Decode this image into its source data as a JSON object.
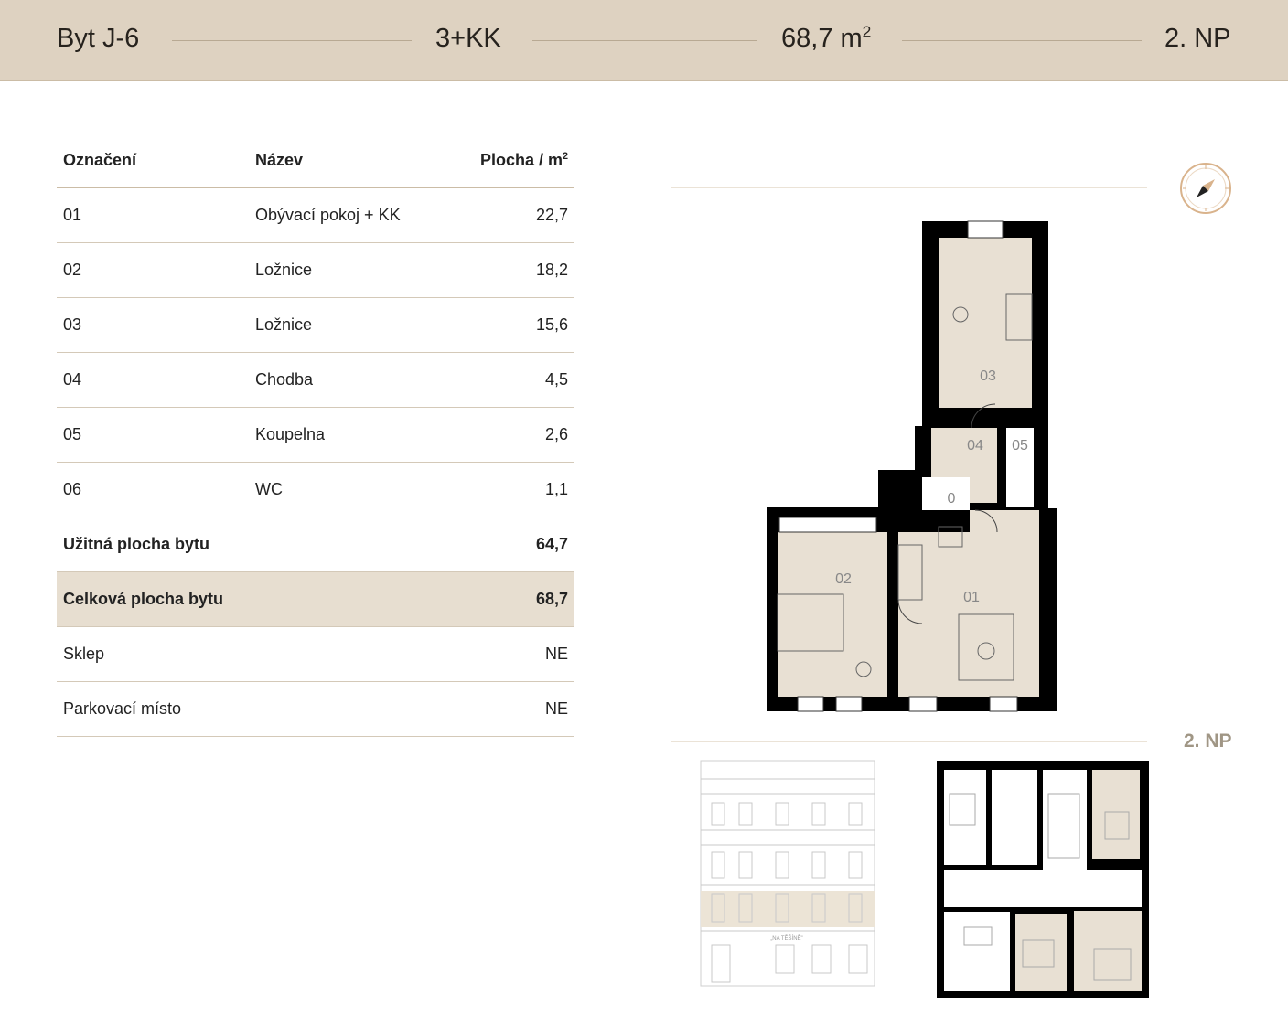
{
  "header": {
    "unit": "Byt J-6",
    "layout": "3+KK",
    "area": "68,7 m",
    "area_sup": "2",
    "floor": "2. NP"
  },
  "table": {
    "columns": {
      "code": "Označení",
      "name": "Název",
      "area": "Plocha / m",
      "area_sup": "2"
    },
    "rows": [
      {
        "code": "01",
        "name": "Obývací pokoj + KK",
        "area": "22,7"
      },
      {
        "code": "02",
        "name": "Ložnice",
        "area": "18,2"
      },
      {
        "code": "03",
        "name": "Ložnice",
        "area": "15,6"
      },
      {
        "code": "04",
        "name": "Chodba",
        "area": "4,5"
      },
      {
        "code": "05",
        "name": "Koupelna",
        "area": "2,6"
      },
      {
        "code": "06",
        "name": "WC",
        "area": "1,1"
      }
    ],
    "usable": {
      "label": "Užitná plocha bytu",
      "value": "64,7"
    },
    "total": {
      "label": "Celková plocha bytu",
      "value": "68,7"
    },
    "cellar": {
      "label": "Sklep",
      "value": "NE"
    },
    "parking": {
      "label": "Parkovací místo",
      "value": "NE"
    }
  },
  "plan": {
    "room_labels": [
      "01",
      "02",
      "03",
      "04",
      "05",
      "0"
    ],
    "floor_label": "2. NP",
    "facade_sign": "„NA TĚŠÍNĚ\""
  },
  "colors": {
    "header_bg": "#ded2c1",
    "room_fill": "#e8e0d3",
    "wall": "#000000",
    "accent": "#d9b38c"
  }
}
